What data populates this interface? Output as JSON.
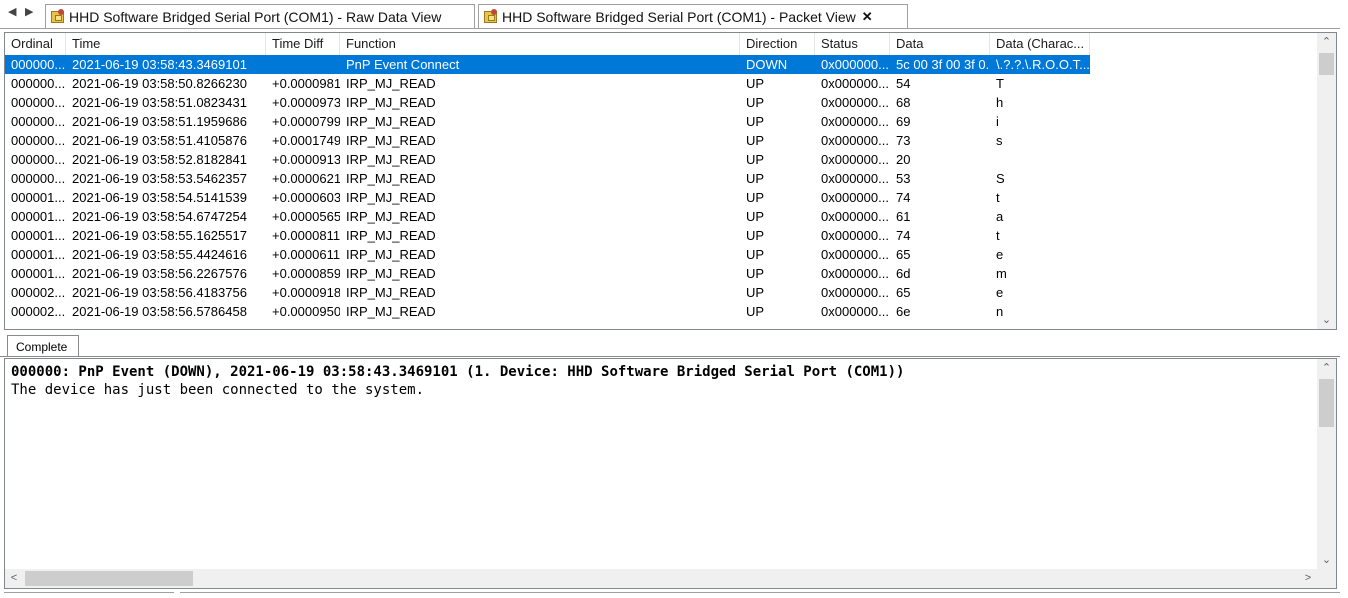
{
  "tabs": [
    {
      "label": "HHD Software Bridged Serial Port (COM1) - Raw Data View"
    },
    {
      "label": "HHD Software Bridged Serial Port (COM1) - Packet View",
      "close": "✕"
    }
  ],
  "nav": {
    "prev": "◀",
    "next": "▶"
  },
  "columns": [
    "Ordinal",
    "Time",
    "Time Diff",
    "Function",
    "Direction",
    "Status",
    "Data",
    "Data (Charac..."
  ],
  "rows": [
    {
      "ordinal": "000000...",
      "time": "2021-06-19 03:58:43.3469101",
      "diff": "",
      "function": "PnP Event Connect",
      "direction": "DOWN",
      "status": "0x000000...",
      "data": "5c 00 3f 00 3f 0...",
      "chars": "\\.?.?.\\.R.O.O.T..."
    },
    {
      "ordinal": "000000...",
      "time": "2021-06-19 03:58:50.8266230",
      "diff": "+0.0000981",
      "function": "IRP_MJ_READ",
      "direction": "UP",
      "status": "0x000000...",
      "data": "54",
      "chars": "T"
    },
    {
      "ordinal": "000000...",
      "time": "2021-06-19 03:58:51.0823431",
      "diff": "+0.0000973",
      "function": "IRP_MJ_READ",
      "direction": "UP",
      "status": "0x000000...",
      "data": "68",
      "chars": "h"
    },
    {
      "ordinal": "000000...",
      "time": "2021-06-19 03:58:51.1959686",
      "diff": "+0.0000799",
      "function": "IRP_MJ_READ",
      "direction": "UP",
      "status": "0x000000...",
      "data": "69",
      "chars": "i"
    },
    {
      "ordinal": "000000...",
      "time": "2021-06-19 03:58:51.4105876",
      "diff": "+0.0001749",
      "function": "IRP_MJ_READ",
      "direction": "UP",
      "status": "0x000000...",
      "data": "73",
      "chars": "s"
    },
    {
      "ordinal": "000000...",
      "time": "2021-06-19 03:58:52.8182841",
      "diff": "+0.0000913",
      "function": "IRP_MJ_READ",
      "direction": "UP",
      "status": "0x000000...",
      "data": "20",
      "chars": ""
    },
    {
      "ordinal": "000000...",
      "time": "2021-06-19 03:58:53.5462357",
      "diff": "+0.0000621",
      "function": "IRP_MJ_READ",
      "direction": "UP",
      "status": "0x000000...",
      "data": "53",
      "chars": "S"
    },
    {
      "ordinal": "000001...",
      "time": "2021-06-19 03:58:54.5141539",
      "diff": "+0.0000603",
      "function": "IRP_MJ_READ",
      "direction": "UP",
      "status": "0x000000...",
      "data": "74",
      "chars": "t"
    },
    {
      "ordinal": "000001...",
      "time": "2021-06-19 03:58:54.6747254",
      "diff": "+0.0000565",
      "function": "IRP_MJ_READ",
      "direction": "UP",
      "status": "0x000000...",
      "data": "61",
      "chars": "a"
    },
    {
      "ordinal": "000001...",
      "time": "2021-06-19 03:58:55.1625517",
      "diff": "+0.0000811",
      "function": "IRP_MJ_READ",
      "direction": "UP",
      "status": "0x000000...",
      "data": "74",
      "chars": "t"
    },
    {
      "ordinal": "000001...",
      "time": "2021-06-19 03:58:55.4424616",
      "diff": "+0.0000611",
      "function": "IRP_MJ_READ",
      "direction": "UP",
      "status": "0x000000...",
      "data": "65",
      "chars": "e"
    },
    {
      "ordinal": "000001...",
      "time": "2021-06-19 03:58:56.2267576",
      "diff": "+0.0000859",
      "function": "IRP_MJ_READ",
      "direction": "UP",
      "status": "0x000000...",
      "data": "6d",
      "chars": "m"
    },
    {
      "ordinal": "000002...",
      "time": "2021-06-19 03:58:56.4183756",
      "diff": "+0.0000918",
      "function": "IRP_MJ_READ",
      "direction": "UP",
      "status": "0x000000...",
      "data": "65",
      "chars": "e"
    },
    {
      "ordinal": "000002...",
      "time": "2021-06-19 03:58:56.5786458",
      "diff": "+0.0000950",
      "function": "IRP_MJ_READ",
      "direction": "UP",
      "status": "0x000000...",
      "data": "6e",
      "chars": "n"
    }
  ],
  "selected_row": 0,
  "detail_tab": {
    "label": "Complete"
  },
  "detail": {
    "header": "000000: PnP Event (DOWN), 2021-06-19 03:58:43.3469101 (1. Device: HHD Software Bridged Serial Port (COM1))",
    "body": "The device has just been connected to the system."
  },
  "scroll": {
    "up": "⌃",
    "down": "⌄",
    "left": "<",
    "right": ">"
  },
  "colors": {
    "selection": "#0078d7",
    "border": "#828790",
    "scroll_track": "#f0f0f0",
    "scroll_thumb": "#cdcdcd"
  }
}
